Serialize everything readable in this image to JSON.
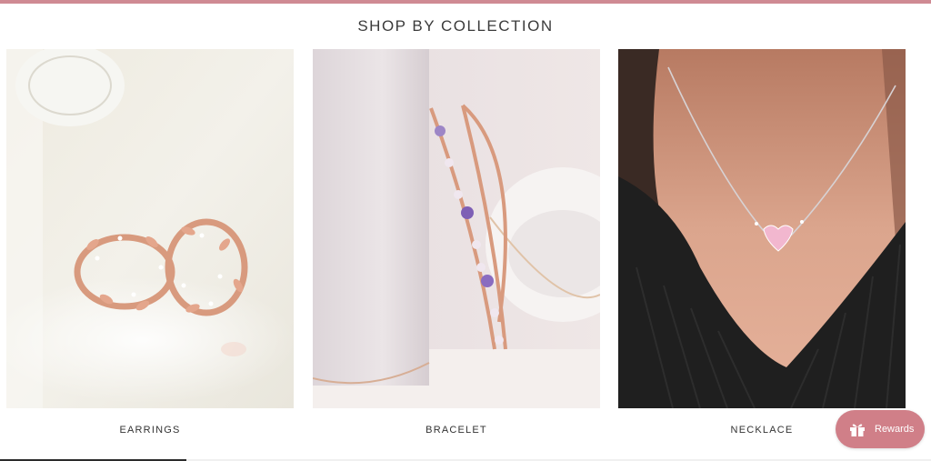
{
  "section": {
    "heading": "SHOP BY COLLECTION"
  },
  "collections": [
    {
      "label": "EARRINGS"
    },
    {
      "label": "BRACELET"
    },
    {
      "label": "NECKLACE"
    }
  ],
  "rewards": {
    "label": "Rewards",
    "icon": "gift-icon"
  },
  "colors": {
    "accent": "#cf8a93",
    "rewards_bg": "#d07f88"
  }
}
